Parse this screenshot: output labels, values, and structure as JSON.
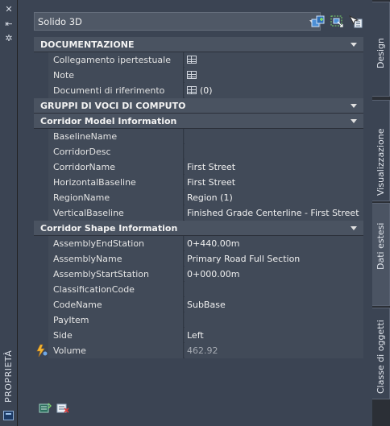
{
  "palette_title": "PROPRIETÀ",
  "selector": {
    "value": "Solido 3D"
  },
  "toolbar": {
    "quick_select_icon": "quick-select-icon",
    "select_objects_icon": "select-objects-icon",
    "toggle_pickadd_icon": "toggle-pickadd-icon"
  },
  "sections": {
    "documentazione": {
      "title": "DOCUMENTAZIONE",
      "rows": [
        {
          "key": "Collegamento ipertestuale",
          "value": ""
        },
        {
          "key": "Note",
          "value": ""
        },
        {
          "key": "Documenti di riferimento",
          "value": "(0)"
        }
      ]
    },
    "gruppi": {
      "title": "GRUPPI DI VOCI DI COMPUTO"
    },
    "corridor_model": {
      "title": "Corridor Model Information",
      "rows": [
        {
          "key": "BaselineName",
          "value": ""
        },
        {
          "key": "CorridorDesc",
          "value": ""
        },
        {
          "key": "CorridorName",
          "value": "First Street"
        },
        {
          "key": "HorizontalBaseline",
          "value": "First Street"
        },
        {
          "key": "RegionName",
          "value": "Region (1)"
        },
        {
          "key": "VerticalBaseline",
          "value": "Finished Grade Centerline - First Street"
        }
      ]
    },
    "corridor_shape": {
      "title": "Corridor Shape Information",
      "rows": [
        {
          "key": "AssemblyEndStation",
          "value": "0+440.00m"
        },
        {
          "key": "AssemblyName",
          "value": "Primary Road Full Section"
        },
        {
          "key": "AssemblyStartStation",
          "value": "0+000.00m"
        },
        {
          "key": "ClassificationCode",
          "value": ""
        },
        {
          "key": "CodeName",
          "value": "SubBase"
        },
        {
          "key": "PayItem",
          "value": ""
        },
        {
          "key": "Side",
          "value": "Left"
        },
        {
          "key": "Volume",
          "value": "462.92"
        }
      ]
    }
  },
  "tabs": [
    {
      "label": "Design",
      "active": false
    },
    {
      "label": "Visualizzazione",
      "active": false
    },
    {
      "label": "Dati estesi",
      "active": true
    },
    {
      "label": "Classe di oggetti",
      "active": false
    }
  ]
}
